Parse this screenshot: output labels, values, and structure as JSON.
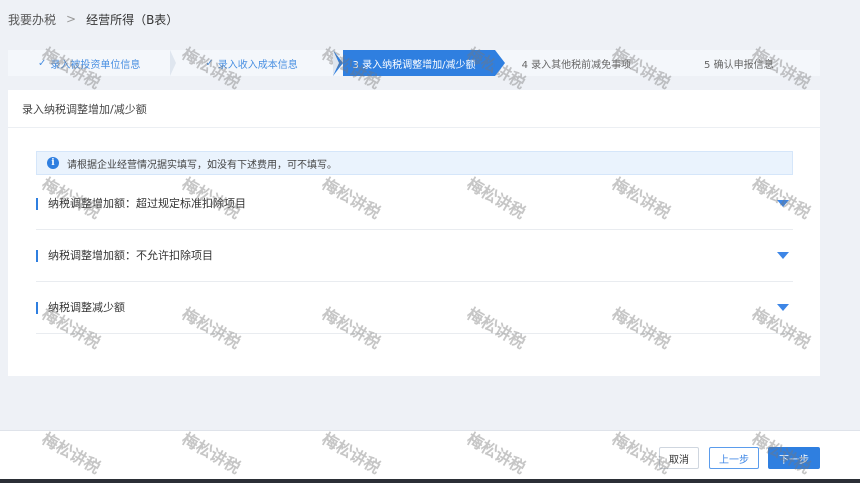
{
  "breadcrumb": {
    "root": "我要办税",
    "separator": ">",
    "current": "经营所得（B表）"
  },
  "steps": [
    {
      "label": "录入被投资单位信息",
      "state": "done"
    },
    {
      "label": "录入收入成本信息",
      "state": "done"
    },
    {
      "label": "3 录入纳税调整增加/减少额",
      "state": "active"
    },
    {
      "label": "4 录入其他税前减免事项",
      "state": "todo"
    },
    {
      "label": "5 确认申报信息",
      "state": "todo"
    }
  ],
  "check_icon": "✓",
  "panel": {
    "title": "录入纳税调整增加/减少额",
    "notice_icon": "i",
    "notice": "请根据企业经营情况据实填写，如没有下述费用，可不填写。"
  },
  "sections": [
    {
      "label": "纳税调整增加额：超过规定标准扣除项目"
    },
    {
      "label": "纳税调整增加额：不允许扣除项目"
    },
    {
      "label": "纳税调整减少额"
    }
  ],
  "footer": {
    "cancel": "取消",
    "prev": "上一步",
    "next": "下一步"
  },
  "watermark": "梅松讲税",
  "colors": {
    "accent": "#2f7fe0",
    "background": "#eef1f6"
  }
}
